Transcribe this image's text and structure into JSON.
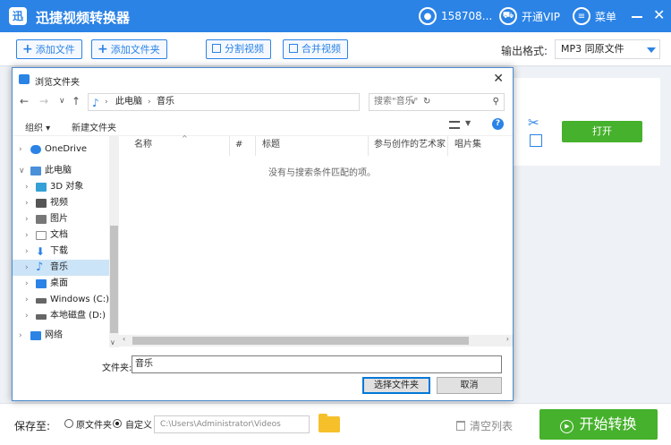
{
  "app": {
    "title": "迅捷视频转换器",
    "logo_glyph": "迅",
    "user_label": "158708...",
    "vip_label": "开通VIP",
    "menu_label": "菜单",
    "close_glyph": "✕"
  },
  "toolbar": {
    "add_file": "添加文件",
    "add_folder": "添加文件夹",
    "split_video": "分割视频",
    "merge_video": "合并视频",
    "format_label": "输出格式:",
    "format_value": "MP3  同原文件"
  },
  "main": {
    "open_button": "打开"
  },
  "footer": {
    "save_label": "保存至:",
    "radio_original": "原文件夹",
    "radio_custom": "自定义",
    "save_path": "C:\\Users\\Administrator\\Videos",
    "clear_list": "清空列表",
    "start_convert": "开始转换"
  },
  "dialog": {
    "title": "浏览文件夹",
    "close_glyph": "✕",
    "breadcrumb": [
      "此电脑",
      "音乐"
    ],
    "search_placeholder": "搜索\"音乐\"",
    "organize": "组织 ▾",
    "new_folder": "新建文件夹",
    "help_glyph": "?",
    "tree": [
      {
        "label": "OneDrive",
        "icon": "cloud-icon",
        "color": "#2b83e6"
      },
      {
        "label": "此电脑",
        "icon": "computer-icon",
        "color": "#4a90d9"
      },
      {
        "label": "3D 对象",
        "icon": "cube-icon",
        "color": "#35a0d6"
      },
      {
        "label": "视频",
        "icon": "video-icon",
        "color": "#555555"
      },
      {
        "label": "图片",
        "icon": "picture-icon",
        "color": "#777777"
      },
      {
        "label": "文档",
        "icon": "document-icon",
        "color": "#8c8c8c"
      },
      {
        "label": "下载",
        "icon": "download-icon",
        "color": "#2b83e6"
      },
      {
        "label": "音乐",
        "icon": "music-icon",
        "color": "#2b83e6",
        "selected": true
      },
      {
        "label": "桌面",
        "icon": "desktop-icon",
        "color": "#2b83e6"
      },
      {
        "label": "Windows (C:)",
        "icon": "drive-icon",
        "color": "#666666"
      },
      {
        "label": "本地磁盘 (D:)",
        "icon": "drive-icon",
        "color": "#666666"
      },
      {
        "label": "网络",
        "icon": "network-icon",
        "color": "#2b83e6"
      }
    ],
    "columns": [
      "名称",
      "#",
      "标题",
      "参与创作的艺术家",
      "唱片集"
    ],
    "empty_message": "没有与搜索条件匹配的项。",
    "filename_label": "文件夹:",
    "filename_value": "音乐",
    "select_button": "选择文件夹",
    "cancel_button": "取消"
  }
}
